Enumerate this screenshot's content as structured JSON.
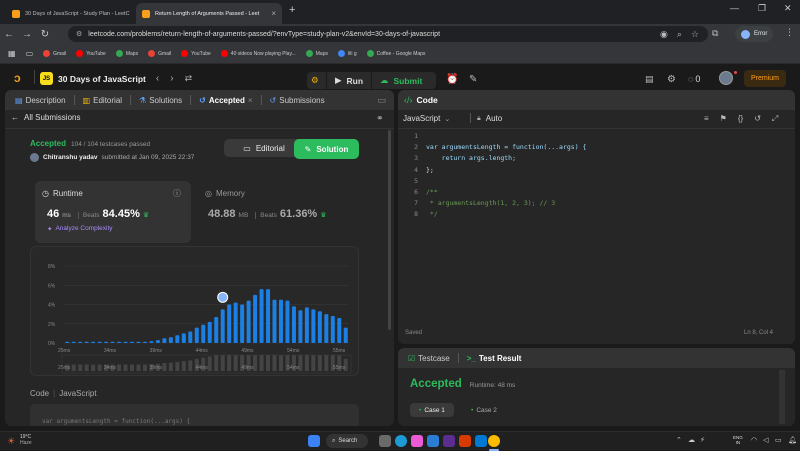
{
  "browser": {
    "tabs": [
      {
        "title": "30 Days of JavaScript - Study Plan - LeetC",
        "active": false
      },
      {
        "title": "Return Length of Arguments Passed - Leet",
        "active": true
      }
    ],
    "new_tab": "+",
    "url": "leetcode.com/problems/return-length-of-arguments-passed/?envType=study-plan-v2&envId=30-days-of-javascript",
    "error_label": "Error",
    "bookmarks": [
      {
        "label": "Gmail",
        "color": "#ea4335"
      },
      {
        "label": "YouTube",
        "color": "#ff0000"
      },
      {
        "label": "Maps",
        "color": "#34a853"
      },
      {
        "label": "Gmail",
        "color": "#ea4335"
      },
      {
        "label": "YouTube",
        "color": "#ff0000"
      },
      {
        "label": "40 videos Now playing Play...",
        "color": "#ff0000"
      },
      {
        "label": "Maps",
        "color": "#34a853"
      },
      {
        "label": "lili g",
        "color": "#4285f4"
      },
      {
        "label": "Coffee - Google Maps",
        "color": "#34a853"
      }
    ]
  },
  "header": {
    "title": "30 Days of JavaScript",
    "run": "Run",
    "submit": "Submit",
    "streak": "0",
    "premium": "Premium"
  },
  "left": {
    "tabs": [
      "Description",
      "Editorial",
      "Solutions",
      "Accepted",
      "Submissions"
    ],
    "all_submissions": "All Submissions",
    "status": "Accepted",
    "testcases": "104 / 104 testcases passed",
    "user": "Chitranshu yadav",
    "submitted_at": "submitted at Jan 09, 2025 22:37",
    "editorial_btn": "Editorial",
    "solution_btn": "Solution",
    "runtime_label": "Runtime",
    "runtime_value": "46",
    "runtime_unit": "ms",
    "runtime_beats_label": "Beats",
    "runtime_beats": "84.45%",
    "analyze": "Analyze Complexity",
    "memory_label": "Memory",
    "memory_value": "48.88",
    "memory_unit": "MB",
    "memory_beats_label": "Beats",
    "memory_beats": "61.36%",
    "code_label": "Code",
    "code_lang": "JavaScript",
    "code_preview": "var argumentsLength = function(...args) {"
  },
  "chart_data": {
    "type": "bar",
    "y_ticks": [
      "8%",
      "6%",
      "4%",
      "2%",
      "0%"
    ],
    "x_ticks": [
      "25ms",
      "34ms",
      "39ms",
      "44ms",
      "49ms",
      "54ms",
      "55ms"
    ],
    "ylim": [
      0,
      8
    ],
    "grid": true,
    "highlighted_index": 24,
    "values": [
      0.1,
      0.1,
      0.1,
      0.1,
      0.1,
      0.1,
      0.1,
      0.1,
      0.1,
      0.1,
      0.1,
      0.1,
      0.1,
      0.2,
      0.3,
      0.5,
      0.6,
      0.8,
      1.0,
      1.2,
      1.6,
      1.9,
      2.2,
      2.7,
      3.5,
      4.0,
      4.2,
      4.0,
      4.4,
      5.0,
      5.6,
      5.6,
      4.5,
      4.5,
      4.4,
      3.8,
      3.4,
      3.7,
      3.5,
      3.3,
      3.0,
      2.8,
      2.6,
      1.6
    ]
  },
  "code": {
    "title": "Code",
    "language": "JavaScript",
    "mode": "Auto",
    "lines": [
      "",
      "var argumentsLength = function(...args) {",
      "    return args.length;",
      "};",
      "",
      "/**",
      " * argumentsLength(1, 2, 3); // 3",
      " */"
    ],
    "saved": "Saved",
    "cursor": "Ln 8, Col 4"
  },
  "result": {
    "testcase_tab": "Testcase",
    "testresult_tab": "Test Result",
    "status": "Accepted",
    "runtime": "Runtime: 48 ms",
    "cases": [
      "Case 1",
      "Case 2"
    ]
  },
  "taskbar": {
    "weather_temp": "19°C",
    "weather_desc": "Haze",
    "search": "Search",
    "lang": "ENG",
    "region": "IN"
  },
  "colors": {
    "accent_green": "#2cbb5d",
    "bar_blue": "#1b7fe3",
    "premium": "#ffa116"
  }
}
